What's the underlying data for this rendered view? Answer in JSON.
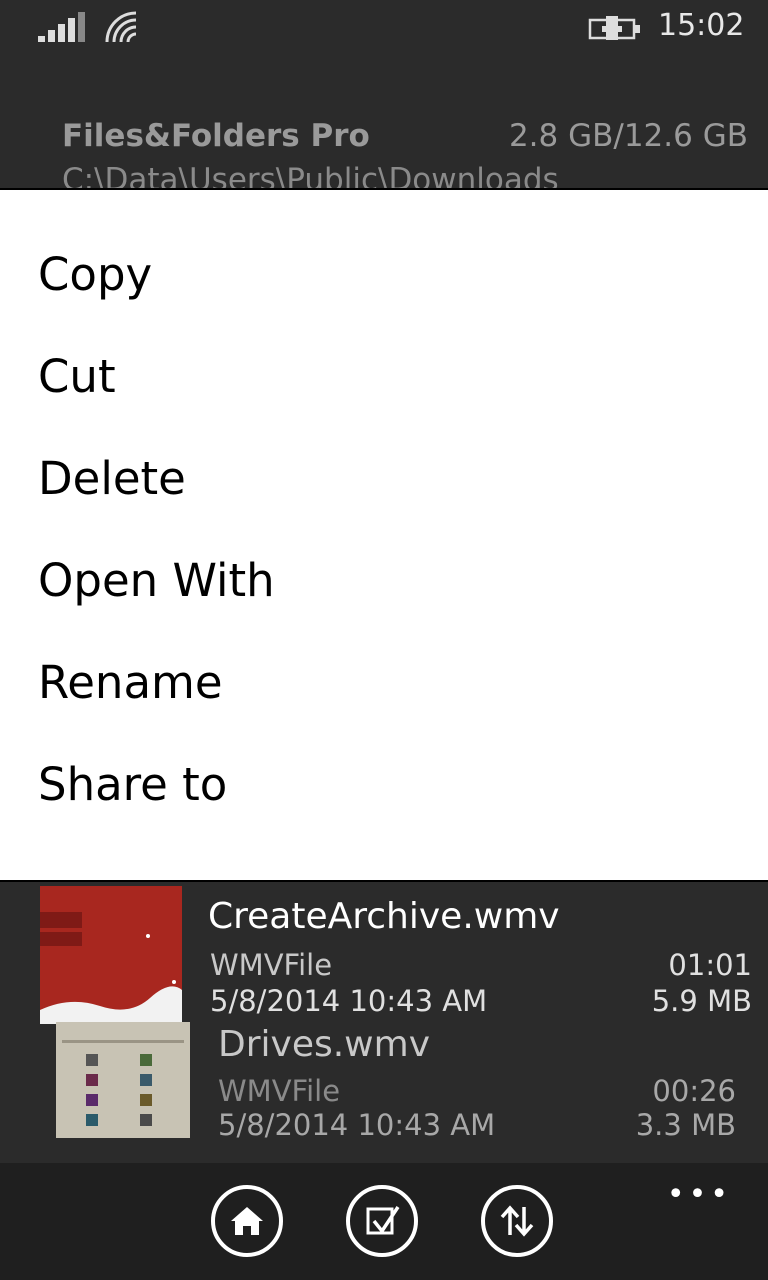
{
  "status": {
    "time": "15:02"
  },
  "header": {
    "app_title": "Files&Folders Pro",
    "storage": "2.8 GB/12.6 GB",
    "path": "C:\\Data\\Users\\Public\\Downloads"
  },
  "menu": {
    "items": [
      "Copy",
      "Cut",
      "Delete",
      "Open With",
      "Rename",
      "Share to"
    ]
  },
  "files": [
    {
      "name": "CreateArchive.wmv",
      "type": "WMVFile",
      "date": "5/8/2014 10:43 AM",
      "duration": "01:01",
      "size": "5.9 MB"
    },
    {
      "name": "Drives.wmv",
      "type": "WMVFile",
      "date": "5/8/2014 10:43 AM",
      "duration": "00:26",
      "size": "3.3 MB"
    }
  ],
  "appbar": {
    "buttons": [
      "home-icon",
      "select-icon",
      "sort-icon"
    ],
    "more": "•••"
  }
}
